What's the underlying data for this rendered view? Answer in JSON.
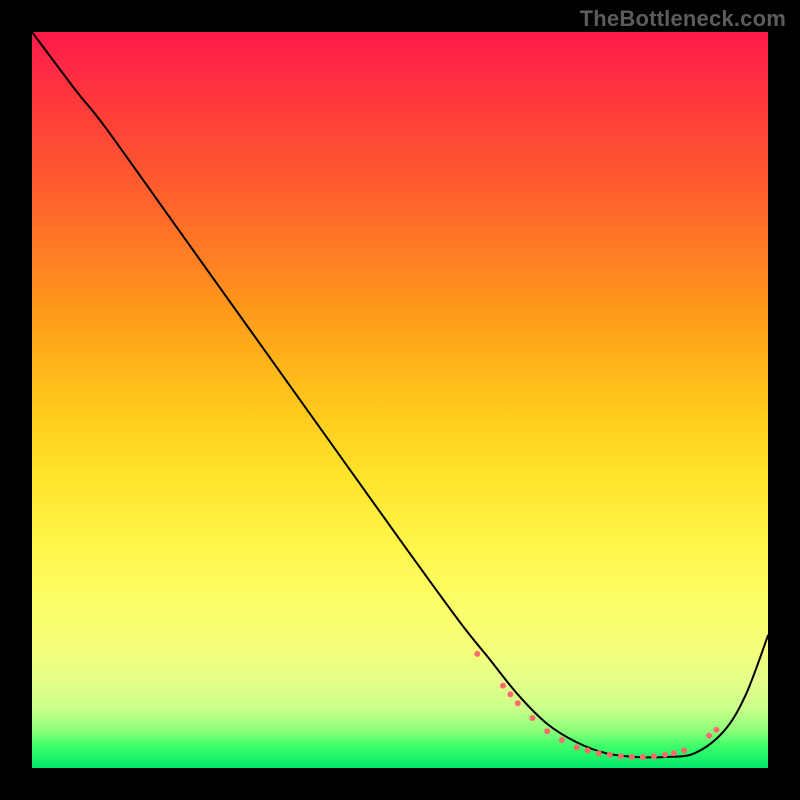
{
  "watermark": "TheBottleneck.com",
  "chart_data": {
    "type": "line",
    "title": "",
    "xlabel": "",
    "ylabel": "",
    "xlim": [
      0,
      1
    ],
    "ylim": [
      0,
      1
    ],
    "series": [
      {
        "name": "main-curve",
        "color": "#000000",
        "x": [
          0.0,
          0.06,
          0.1,
          0.2,
          0.3,
          0.4,
          0.5,
          0.58,
          0.62,
          0.66,
          0.7,
          0.74,
          0.78,
          0.82,
          0.86,
          0.9,
          0.94,
          0.97,
          1.0
        ],
        "y": [
          1.0,
          0.92,
          0.87,
          0.73,
          0.59,
          0.45,
          0.31,
          0.2,
          0.15,
          0.1,
          0.06,
          0.035,
          0.02,
          0.015,
          0.015,
          0.02,
          0.05,
          0.1,
          0.18
        ]
      }
    ],
    "markers": {
      "comment": "dotted highlight along the valley",
      "color": "#ff6a6a",
      "size": 6,
      "points": [
        {
          "x": 0.605,
          "y": 0.155
        },
        {
          "x": 0.64,
          "y": 0.112
        },
        {
          "x": 0.65,
          "y": 0.1
        },
        {
          "x": 0.66,
          "y": 0.088
        },
        {
          "x": 0.68,
          "y": 0.068
        },
        {
          "x": 0.7,
          "y": 0.05
        },
        {
          "x": 0.72,
          "y": 0.038
        },
        {
          "x": 0.74,
          "y": 0.028
        },
        {
          "x": 0.755,
          "y": 0.024
        },
        {
          "x": 0.77,
          "y": 0.02
        },
        {
          "x": 0.785,
          "y": 0.018
        },
        {
          "x": 0.8,
          "y": 0.016
        },
        {
          "x": 0.815,
          "y": 0.015
        },
        {
          "x": 0.83,
          "y": 0.015
        },
        {
          "x": 0.845,
          "y": 0.016
        },
        {
          "x": 0.86,
          "y": 0.018
        },
        {
          "x": 0.872,
          "y": 0.02
        },
        {
          "x": 0.886,
          "y": 0.024
        },
        {
          "x": 0.92,
          "y": 0.044
        },
        {
          "x": 0.93,
          "y": 0.052
        }
      ]
    },
    "background_gradient": {
      "orientation": "vertical",
      "stops": [
        {
          "pos": 0.0,
          "color": "#ff1a4b"
        },
        {
          "pos": 0.5,
          "color": "#ffc51a"
        },
        {
          "pos": 0.8,
          "color": "#f4ff7a"
        },
        {
          "pos": 1.0,
          "color": "#00e86a"
        }
      ]
    }
  }
}
